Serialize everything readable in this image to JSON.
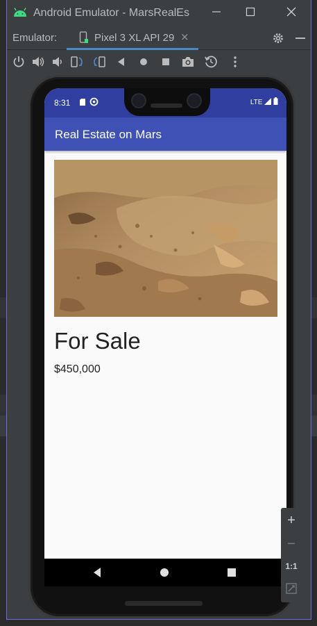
{
  "window": {
    "title": "Android Emulator - MarsRealEs",
    "minimize_icon": "minimize-icon",
    "maximize_icon": "maximize-icon",
    "close_icon": "close-icon"
  },
  "tabbar": {
    "label": "Emulator:",
    "device_tab": "Pixel 3 XL API 29",
    "close_glyph": "×"
  },
  "phone": {
    "status": {
      "time": "8:31",
      "network": "LTE"
    },
    "app_title": "Real Estate on Mars",
    "listing": {
      "type_label": "For Sale",
      "price": "$450,000"
    }
  },
  "zoom": {
    "zoom_in": "+",
    "zoom_out": "−",
    "actual_size": "1:1"
  },
  "colors": {
    "primary": "#3f51b5",
    "primary_dark": "#303f9f",
    "accent_tab": "#4a88c7"
  }
}
